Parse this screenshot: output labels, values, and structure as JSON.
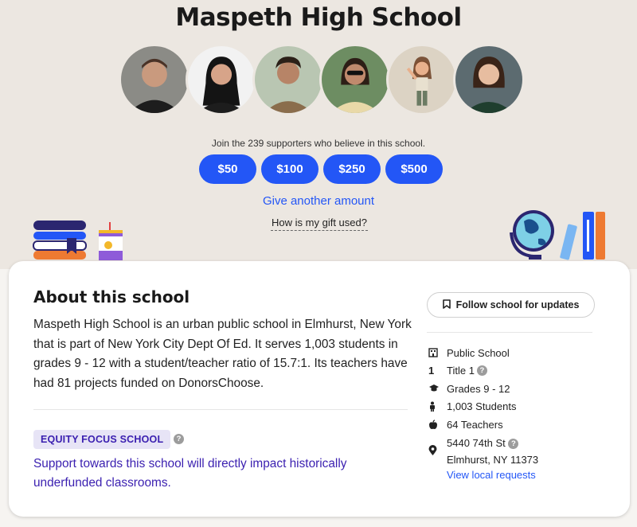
{
  "school": {
    "name": "Maspeth High School"
  },
  "supporters_text": "Join the 239 supporters who believe in this school.",
  "donation": {
    "amounts": [
      "$50",
      "$100",
      "$250",
      "$500"
    ],
    "another_label": "Give another amount",
    "gift_used_label": "How is my gift used?"
  },
  "about": {
    "title": "About this school",
    "description": "Maspeth High School is an urban public school in Elmhurst, New York that is part of New York City Dept Of Ed. It serves 1,003 students in grades 9 - 12 with a student/teacher ratio of 15.7:1. Its teachers have had 81 projects funded on DonorsChoose.",
    "equity_badge": "EQUITY FOCUS SCHOOL",
    "equity_text": "Support towards this school will directly impact historically underfunded classrooms."
  },
  "sidebar": {
    "follow_label": "Follow school for updates",
    "facts": {
      "type": "Public School",
      "title": "Title 1",
      "grades": "Grades 9 - 12",
      "students": "1,003 Students",
      "teachers": "64 Teachers"
    },
    "address": {
      "street": "5440 74th St",
      "city": "Elmhurst, NY 11373"
    },
    "local_link": "View local requests"
  },
  "colors": {
    "accent": "#2356f6",
    "equity": "#3a1fb0",
    "page_bg": "#ece7e1"
  }
}
